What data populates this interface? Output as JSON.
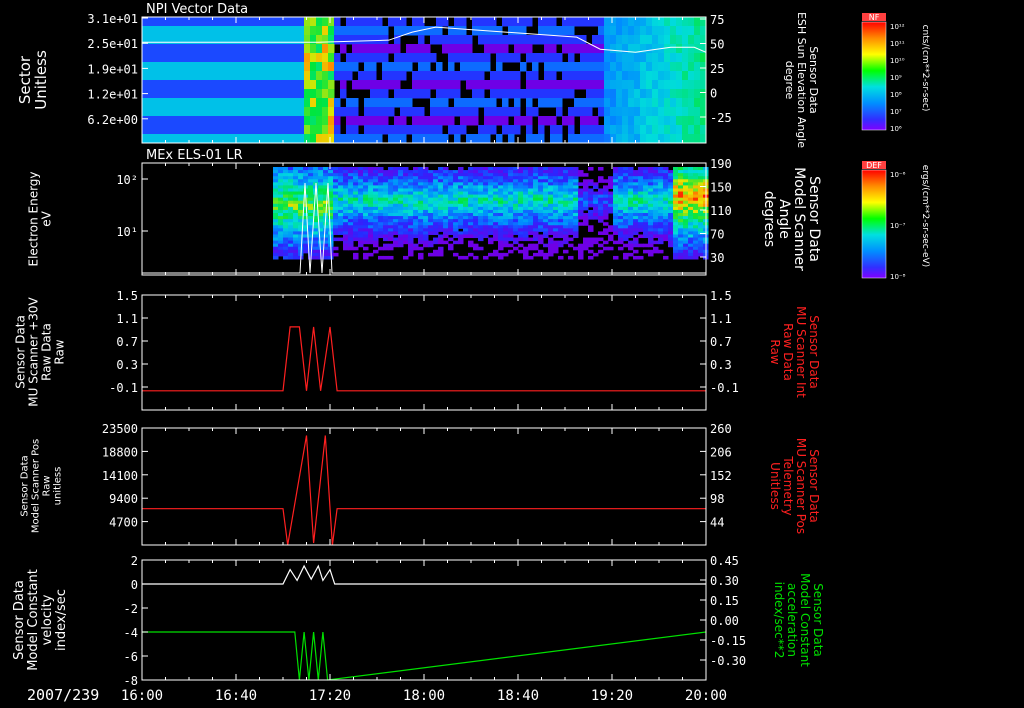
{
  "header": {
    "date_label": "2007/239"
  },
  "x_axis": {
    "tick_labels": [
      "16:00",
      "16:40",
      "17:20",
      "18:00",
      "18:40",
      "19:20",
      "20:00"
    ]
  },
  "colors": {
    "grid": "#ffffff",
    "red_trace": "#ff2020",
    "white_trace": "#ffffff",
    "green_trace": "#00e000",
    "red_label": "#ff2020",
    "green_label": "#00e000"
  },
  "chart_data": [
    {
      "type": "heatmap",
      "title": "NPI Vector Data",
      "ylabel": "Sector Unitless",
      "y_ticks": [
        "3.1e+01",
        "2.5e+01",
        "1.9e+01",
        "1.2e+01",
        "6.2e+00"
      ],
      "right_axis": {
        "label": [
          "Sensor Data",
          "ESH Sun Elevation Angle",
          "degree"
        ],
        "ticks": [
          "75",
          "50",
          "25",
          "0",
          "-25"
        ],
        "ylim": [
          -50,
          75
        ]
      },
      "colorbar": {
        "name": "NF",
        "units": "cnts/(cm**2-sr-sec)",
        "ticks": [
          "10¹²",
          "10¹¹",
          "10¹⁰",
          "10⁹",
          "10⁸",
          "10⁷",
          "10⁶"
        ]
      },
      "overlay_line": {
        "x": [
          "16:00",
          "16:30",
          "17:15",
          "17:45",
          "17:55",
          "18:05",
          "19:05",
          "19:15",
          "19:30",
          "19:45",
          "19:55",
          "20:00"
        ],
        "y": [
          50,
          50,
          50,
          52,
          60,
          65,
          55,
          43,
          40,
          45,
          45,
          40
        ]
      }
    },
    {
      "type": "heatmap",
      "title": "MEx ELS-01 LR",
      "ylabel": "Electron Energy eV",
      "y_ticks": [
        "10²",
        "10¹"
      ],
      "right_axis": {
        "label": [
          "Sensor Data",
          "Model Scanner",
          "Angle",
          "degrees"
        ],
        "ticks": [
          "190",
          "150",
          "110",
          "70",
          "30"
        ],
        "ylim": [
          0,
          190
        ]
      },
      "colorbar": {
        "name": "DEF",
        "units": "ergs/(cm**2-sr-sec-eV)",
        "ticks": [
          "10⁻⁶",
          "10⁻⁷",
          "10⁻⁸"
        ]
      }
    },
    {
      "type": "line",
      "ylabel": "Sensor Data MU Scanner +30V Raw Data Raw",
      "ylim": [
        -0.3,
        1.5
      ],
      "y_ticks": [
        "1.5",
        "1.1",
        "0.7",
        "0.3",
        "-0.1"
      ],
      "right_axis": {
        "label": [
          "Sensor Data",
          "MU Scanner Int",
          "Raw Data",
          "Raw"
        ],
        "ticks": [
          "1.5",
          "1.1",
          "0.7",
          "0.3",
          "-0.1"
        ]
      },
      "series": [
        {
          "x": [
            "16:00",
            "17:00",
            "17:03",
            "17:07",
            "17:10",
            "17:13",
            "17:16",
            "17:20",
            "17:23",
            "20:00"
          ],
          "values": [
            0,
            0,
            1,
            1,
            0,
            1,
            0,
            1,
            0,
            0
          ]
        }
      ]
    },
    {
      "type": "line",
      "ylabel": "Sensor Data Model Scanner Pos Raw unitless",
      "ylim": [
        0,
        23500
      ],
      "y_ticks": [
        "23500",
        "18800",
        "14100",
        "9400",
        "4700"
      ],
      "right_axis": {
        "label": [
          "Sensor Data",
          "MU Scanner Pos",
          "Telemetry",
          "Unitless"
        ],
        "ticks": [
          "260",
          "206",
          "152",
          "98",
          "44"
        ]
      },
      "series": [
        {
          "x": [
            "16:00",
            "17:00",
            "17:02",
            "17:10",
            "17:13",
            "17:18",
            "17:21",
            "17:23",
            "20:00"
          ],
          "values": [
            7300,
            7300,
            0,
            22000,
            400,
            22000,
            0,
            7300,
            7300
          ]
        }
      ]
    },
    {
      "type": "line",
      "ylabel": "Sensor Data Model Constant velocity index/sec",
      "ylim": [
        -8,
        2
      ],
      "y_ticks": [
        "2",
        "0",
        "-2",
        "-4",
        "-6",
        "-8"
      ],
      "right_axis": {
        "label": [
          "Sensor Data",
          "Model Constant",
          "acceleration",
          "index/sec**2"
        ],
        "ticks": [
          "0.45",
          "0.30",
          "0.15",
          "0.00",
          "-0.15",
          "-0.30"
        ]
      },
      "series": [
        {
          "x": [
            "16:00",
            "17:00",
            "17:03",
            "17:06",
            "17:09",
            "17:12",
            "17:15",
            "17:17",
            "17:20",
            "17:22",
            "20:00"
          ],
          "values": [
            0,
            0,
            1.2,
            0.3,
            1.5,
            0.4,
            1.5,
            0.3,
            1.2,
            0,
            0
          ]
        },
        {
          "x": [
            "16:00",
            "17:05",
            "17:07",
            "17:09",
            "17:11",
            "17:13",
            "17:15",
            "17:17",
            "17:19",
            "20:00"
          ],
          "values": [
            -4,
            -4,
            -8,
            -4,
            -8,
            -4,
            -8,
            -4,
            -8,
            -4
          ]
        }
      ]
    }
  ]
}
